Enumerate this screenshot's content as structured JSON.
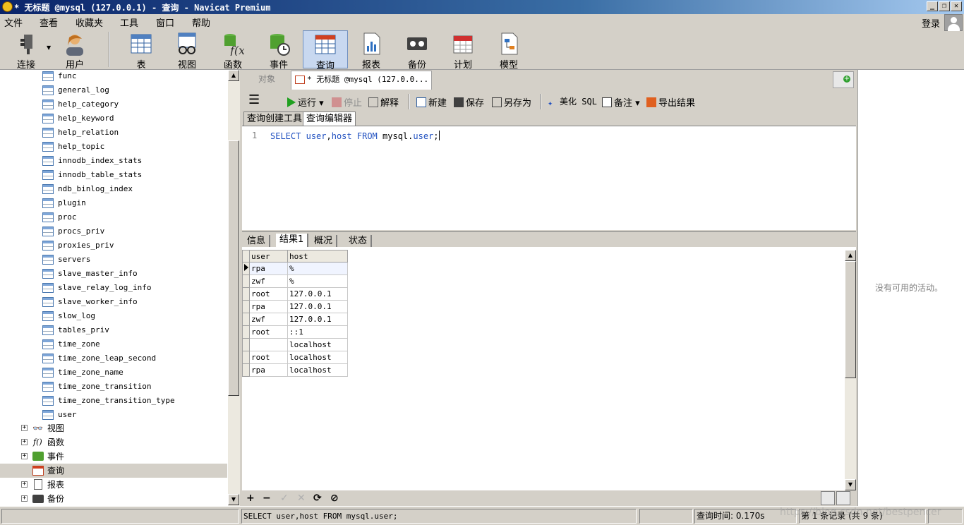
{
  "window": {
    "title": "* 无标题 @mysql (127.0.0.1) - 查询 - Navicat Premium",
    "min": "_",
    "restore": "❐",
    "close": "✕"
  },
  "menu": [
    "文件",
    "查看",
    "收藏夹",
    "工具",
    "窗口",
    "帮助"
  ],
  "login": "登录",
  "toolbar": {
    "connect": "连接",
    "user": "用户",
    "table": "表",
    "view": "视图",
    "function": "函数",
    "event": "事件",
    "query": "查询",
    "report": "报表",
    "backup": "备份",
    "schedule": "计划",
    "model": "模型"
  },
  "tree": {
    "tables": [
      "func",
      "general_log",
      "help_category",
      "help_keyword",
      "help_relation",
      "help_topic",
      "innodb_index_stats",
      "innodb_table_stats",
      "ndb_binlog_index",
      "plugin",
      "proc",
      "procs_priv",
      "proxies_priv",
      "servers",
      "slave_master_info",
      "slave_relay_log_info",
      "slave_worker_info",
      "slow_log",
      "tables_priv",
      "time_zone",
      "time_zone_leap_second",
      "time_zone_name",
      "time_zone_transition",
      "time_zone_transition_type",
      "user"
    ],
    "groups": {
      "views": "视图",
      "functions": "函数",
      "events": "事件",
      "queries": "查询",
      "reports": "报表",
      "backups": "备份"
    }
  },
  "tabs": {
    "objects": "对象",
    "query": "* 无标题 @mysql (127.0.0..."
  },
  "editor_toolbar": {
    "run": "运行",
    "stop": "停止",
    "explain": "解释",
    "new": "新建",
    "save": "保存",
    "save_as": "另存为",
    "beautify": "美化 SQL",
    "comment": "备注",
    "export": "导出结果"
  },
  "subtabs": {
    "builder": "查询创建工具",
    "editor": "查询编辑器"
  },
  "editor": {
    "line": "1",
    "kw_select": "SELECT",
    "col_user": "user",
    "comma": ",",
    "col_host": "host",
    "kw_from": "FROM",
    "schema": "mysql.",
    "tbl": "user",
    "semicolon": ";"
  },
  "result_tabs": {
    "info": "信息",
    "result1": "结果1",
    "profile": "概况",
    "status": "状态"
  },
  "grid": {
    "columns": [
      "user",
      "host"
    ],
    "rows": [
      [
        "rpa",
        "%"
      ],
      [
        "zwf",
        "%"
      ],
      [
        "root",
        "127.0.0.1"
      ],
      [
        "rpa",
        "127.0.0.1"
      ],
      [
        "zwf",
        "127.0.0.1"
      ],
      [
        "root",
        "::1"
      ],
      [
        "",
        "localhost"
      ],
      [
        "root",
        "localhost"
      ],
      [
        "rpa",
        "localhost"
      ]
    ]
  },
  "bottom": {
    "add": "+",
    "remove": "−",
    "apply": "✓",
    "discard": "✕",
    "refresh": "⟳",
    "stop": "⊘"
  },
  "right_panel": {
    "message": "没有可用的活动。"
  },
  "status": {
    "sql": "SELECT user,host FROM mysql.user;",
    "query_time": "查询时间: 0.170s",
    "records": "第 1 条记录 (共 9 条)",
    "watermark": "https://blog.csdn.net/bestpencer"
  }
}
